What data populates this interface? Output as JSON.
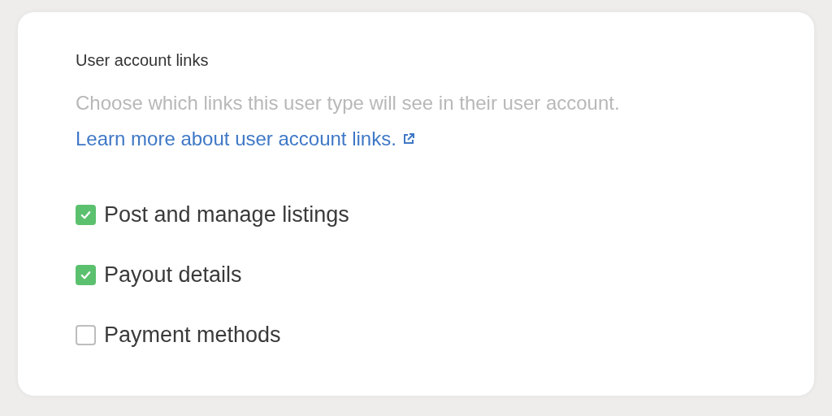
{
  "section": {
    "title": "User account links",
    "description": "Choose which links this user type will see in their user account.",
    "link": "Learn more about user account links."
  },
  "options": [
    {
      "label": "Post and manage listings",
      "checked": true
    },
    {
      "label": "Payout details",
      "checked": true
    },
    {
      "label": "Payment methods",
      "checked": false
    }
  ]
}
